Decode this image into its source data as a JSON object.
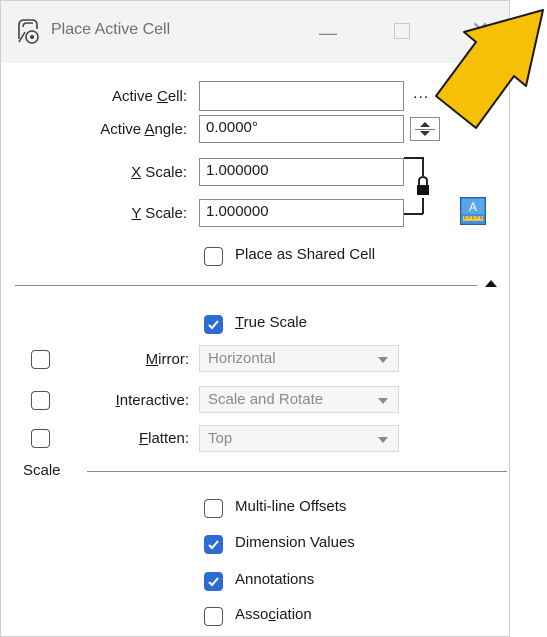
{
  "window": {
    "title": "Place Active Cell",
    "app_icon": "place-cell-icon",
    "controls": [
      "minimize-icon",
      "maximize-icon",
      "close-icon"
    ]
  },
  "annotation": {
    "arrow_color": "#f8bf07",
    "arrow_icon": "arrow-pointer-icon"
  },
  "fields": {
    "active_cell": {
      "label_pre": "Active ",
      "label_u": "C",
      "label_post": "ell:",
      "value": "",
      "browse_label": "..."
    },
    "active_angle": {
      "label_pre": "Active ",
      "label_u": "A",
      "label_post": "ngle:",
      "value": "0.0000°"
    },
    "x_scale": {
      "label_pre": "",
      "label_u": "X",
      "label_post": " Scale:",
      "value": "1.000000"
    },
    "y_scale": {
      "label_pre": "",
      "label_u": "Y",
      "label_post": " Scale:",
      "value": "1.000000"
    }
  },
  "place_shared": {
    "label": "Place as Shared Cell",
    "checked": false
  },
  "true_scale": {
    "label_u": "T",
    "label_post": "rue Scale",
    "checked": true
  },
  "mirror": {
    "label_u": "M",
    "label_post": "irror:",
    "value": "Horizontal",
    "enabled": false
  },
  "interactive": {
    "label_u": "I",
    "label_post": "nteractive:",
    "value": "Scale and Rotate",
    "enabled": false
  },
  "flatten": {
    "label_u": "F",
    "label_post": "latten:",
    "value": "Top",
    "enabled": false
  },
  "scale_section": {
    "title": "Scale"
  },
  "scale_options": [
    {
      "label": "Multi-line Offsets",
      "checked": false
    },
    {
      "label": "Dimension Values",
      "checked": true
    },
    {
      "label": "Annotations",
      "checked": true
    },
    {
      "label_pre": "Asso",
      "label_u": "c",
      "label_post": "iation",
      "checked": false
    }
  ],
  "colors": {
    "accent": "#2c6cd4",
    "arrow": "#f8bf07"
  }
}
